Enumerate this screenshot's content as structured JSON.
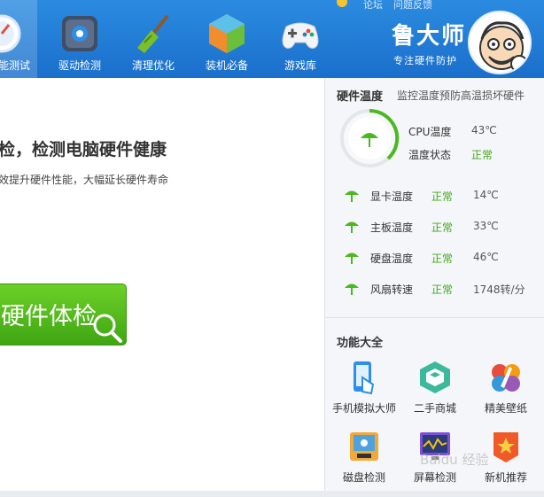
{
  "nav": {
    "items": [
      {
        "label": "能测试",
        "icon": "gauge-icon",
        "active": true
      },
      {
        "label": "驱动检测",
        "icon": "gear-chip-icon",
        "active": false
      },
      {
        "label": "清理优化",
        "icon": "broom-icon",
        "active": false
      },
      {
        "label": "装机必备",
        "icon": "cube-icon",
        "active": false
      },
      {
        "label": "游戏库",
        "icon": "gamepad-icon",
        "active": false
      }
    ],
    "top_links": [
      "论坛",
      "问题反馈"
    ]
  },
  "brand": {
    "name": "鲁大师",
    "slogan": "专注硬件防护"
  },
  "main": {
    "title": "检，检测电脑硬件健康",
    "subtitle": "效提升硬件性能，大幅延长硬件寿命",
    "scan_button": "硬件体检"
  },
  "hardware_temp": {
    "title": "硬件温度",
    "description": "监控温度预防高温损坏硬件",
    "cpu_label": "CPU温度",
    "cpu_value": "43℃",
    "status_label": "温度状态",
    "status_value": "正常",
    "rows": [
      {
        "label": "显卡温度",
        "status": "正常",
        "value": "14℃"
      },
      {
        "label": "主板温度",
        "status": "正常",
        "value": "33℃"
      },
      {
        "label": "硬盘温度",
        "status": "正常",
        "value": "46℃"
      },
      {
        "label": "风扇转速",
        "status": "正常",
        "value": "1748转/分"
      }
    ]
  },
  "functions": {
    "title": "功能大全",
    "items": [
      {
        "label": "手机模拟大师",
        "icon": "phone-simulator-icon"
      },
      {
        "label": "二手商城",
        "icon": "secondhand-mall-icon"
      },
      {
        "label": "精美壁纸",
        "icon": "wallpaper-icon"
      },
      {
        "label": "磁盘检测",
        "icon": "disk-check-icon"
      },
      {
        "label": "屏幕检测",
        "icon": "screen-check-icon"
      },
      {
        "label": "新机推荐",
        "icon": "new-device-icon"
      }
    ]
  },
  "watermark": "Baidu 经验",
  "colors": {
    "header": "#2b8be0",
    "accent_green": "#44a818",
    "scan_button": "#4fb81c"
  }
}
